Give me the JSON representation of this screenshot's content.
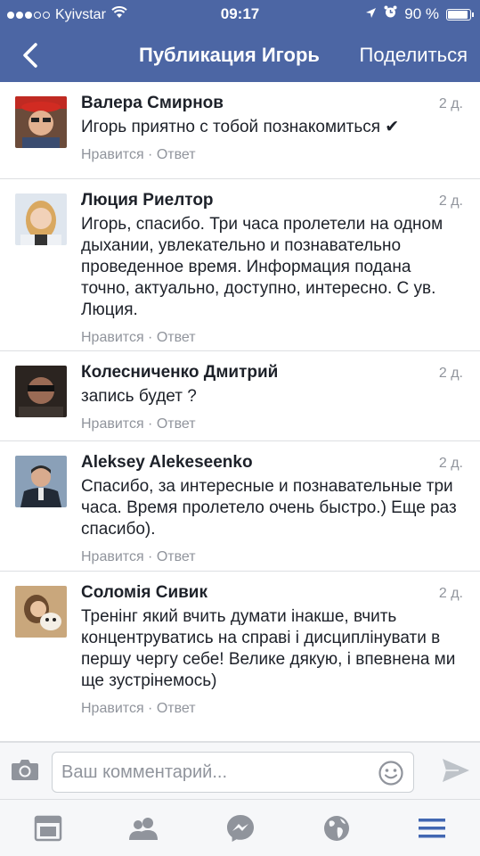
{
  "status_bar": {
    "carrier": "Kyivstar",
    "time": "09:17",
    "battery": "90 %",
    "battery_level": 0.9
  },
  "nav": {
    "title": "Публикация Игорь",
    "share_label": "Поделиться"
  },
  "comments": [
    {
      "author": "Валера Смирнов",
      "time": "2 д.",
      "text": "Игорь приятно с тобой познакомиться ✔",
      "like": "Нравится",
      "separator": " · ",
      "reply": "Ответ"
    },
    {
      "author": "Люция Риелтор",
      "time": "2 д.",
      "text": "Игорь, спасибо. Три часа пролетели на одном дыхании, увлекательно и познавательно проведенное время. Информация подана  точно, актуально, доступно, интересно.  С ув. Люция.",
      "like": "Нравится",
      "separator": " · ",
      "reply": "Ответ"
    },
    {
      "author": "Колесниченко Дмитрий",
      "time": "2 д.",
      "text": "запись будет ?",
      "like": "Нравится",
      "separator": " · ",
      "reply": "Ответ"
    },
    {
      "author": "Aleksey  Alekeseenko",
      "time": "2 д.",
      "text": "Спасибо, за интересные и познавательные три часа. Время пролетело очень быстро.) Еще раз спасибо).",
      "like": "Нравится",
      "separator": " · ",
      "reply": "Ответ"
    },
    {
      "author": "Соломія Сивик",
      "time": "2 д.",
      "text": "Тренінг який вчить думати інакше, вчить концентруватись на справі і дисциплінувати в першу чергу себе! Велике дякую, і впевнена ми ще зустрінемось)",
      "like": "Нравится",
      "separator": " · ",
      "reply": "Ответ"
    }
  ],
  "composer": {
    "placeholder": "Ваш комментарий..."
  },
  "icons": {
    "back": "chevron-left-icon",
    "camera": "camera-icon",
    "smiley": "smiley-icon",
    "send": "send-icon",
    "tabs": [
      "news-feed-icon",
      "friends-icon",
      "messenger-icon",
      "globe-icon",
      "menu-icon"
    ]
  },
  "colors": {
    "brand": "#4c66a4",
    "active_tab": "#4267b2",
    "inactive_tab": "#90949c"
  }
}
